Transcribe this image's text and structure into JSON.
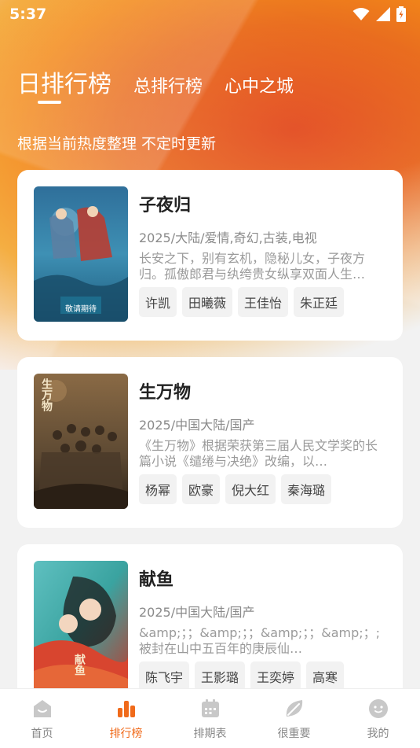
{
  "status_bar": {
    "time": "5:37"
  },
  "tabs": [
    {
      "label": "日排行榜",
      "active": true
    },
    {
      "label": "总排行榜",
      "active": false
    },
    {
      "label": "心中之城",
      "active": false
    }
  ],
  "subtitle": "根据当前热度整理 不定时更新",
  "items": [
    {
      "title": "子夜归",
      "meta": "2025/大陆/爱情,奇幻,古装,电视",
      "desc": "长安之下，别有玄机，隐秘儿女，子夜方归。孤傲郎君与纨绔贵女纵享双面人生…",
      "tags": [
        "许凯",
        "田曦薇",
        "王佳怡",
        "朱正廷"
      ],
      "poster_text": "敬请期待"
    },
    {
      "title": "生万物",
      "meta": "2025/中国大陆/国产",
      "desc": "《生万物》根据荣获第三届人民文学奖的长篇小说《缱绻与决绝》改编，以…",
      "tags": [
        "杨幂",
        "欧豪",
        "倪大红",
        "秦海璐"
      ],
      "poster_text": "生万物"
    },
    {
      "title": "献鱼",
      "meta": "2025/中国大陆/国产",
      "desc": "&amp;；；&amp;；；&amp;；；&amp;；;被封在山中五百年的庚辰仙…",
      "tags": [
        "陈飞宇",
        "王影璐",
        "王奕婷",
        "高寒"
      ],
      "poster_text": "献鱼"
    }
  ],
  "bottom_nav": [
    {
      "label": "首页",
      "icon": "home-icon",
      "active": false
    },
    {
      "label": "排行榜",
      "icon": "ranking-icon",
      "active": true
    },
    {
      "label": "排期表",
      "icon": "calendar-icon",
      "active": false
    },
    {
      "label": "很重要",
      "icon": "leaf-icon",
      "active": false
    },
    {
      "label": "我的",
      "icon": "profile-icon",
      "active": false
    }
  ],
  "colors": {
    "accent": "#f06a1a",
    "nav_inactive": "#c8c8c8"
  }
}
